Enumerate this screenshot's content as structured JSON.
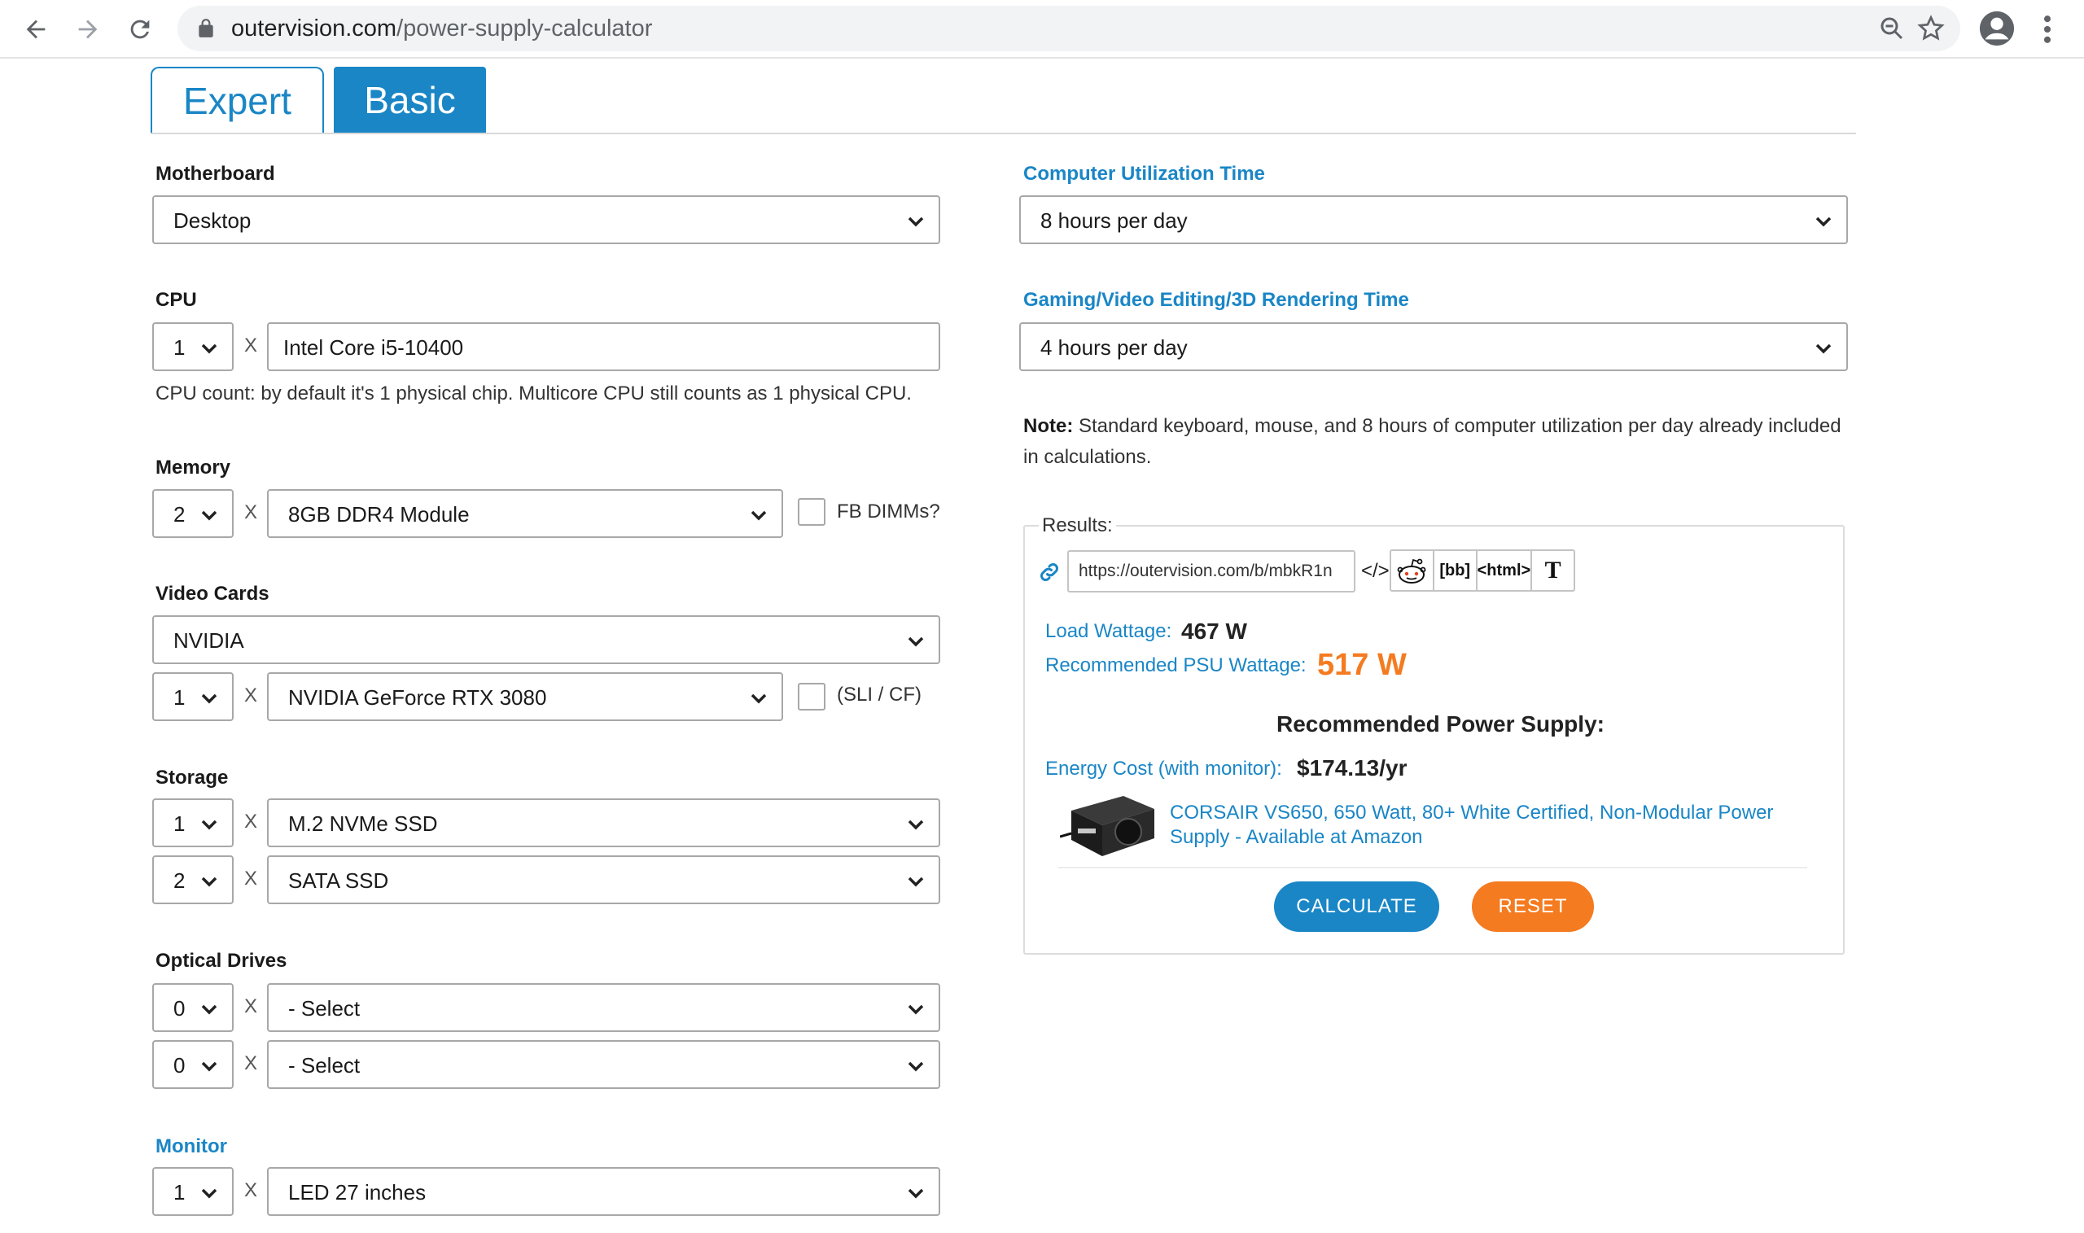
{
  "browser": {
    "url_host": "outervision.com",
    "url_path": "/power-supply-calculator"
  },
  "tabs": {
    "expert": "Expert",
    "basic": "Basic"
  },
  "motherboard": {
    "label": "Motherboard",
    "value": "Desktop"
  },
  "cpu": {
    "label": "CPU",
    "count": "1",
    "x": "X",
    "model": "Intel Core i5-10400",
    "help": "CPU count: by default it's 1 physical chip. Multicore CPU still counts as 1 physical CPU."
  },
  "memory": {
    "label": "Memory",
    "count": "2",
    "x": "X",
    "module": "8GB DDR4 Module",
    "fb_dimms_label": "FB DIMMs?",
    "fb_dimms_checked": false
  },
  "video_cards": {
    "label": "Video Cards",
    "brand": "NVIDIA",
    "count": "1",
    "x": "X",
    "model": "NVIDIA GeForce RTX 3080",
    "sli_label": "(SLI / CF)",
    "sli_checked": false
  },
  "storage": {
    "label": "Storage",
    "rows": [
      {
        "count": "1",
        "x": "X",
        "type": "M.2 NVMe SSD"
      },
      {
        "count": "2",
        "x": "X",
        "type": "SATA SSD"
      }
    ]
  },
  "optical": {
    "label": "Optical Drives",
    "rows": [
      {
        "count": "0",
        "x": "X",
        "type": "- Select"
      },
      {
        "count": "0",
        "x": "X",
        "type": "- Select"
      }
    ]
  },
  "monitor": {
    "label": "Monitor",
    "count": "1",
    "x": "X",
    "type": "LED 27 inches"
  },
  "utilization": {
    "label": "Computer Utilization Time",
    "value": "8 hours per day"
  },
  "gaming": {
    "label": "Gaming/Video Editing/3D Rendering Time",
    "value": "4 hours per day"
  },
  "note": {
    "bold": "Note:",
    "text": " Standard keyboard, mouse, and 8 hours of computer utilization per day already included in calculations."
  },
  "results": {
    "legend": "Results:",
    "share_url": "https://outervision.com/b/mbkR1n",
    "embed_symbol": "</>",
    "share_buttons": {
      "bb": "[bb]",
      "html": "<html>",
      "text": "T"
    },
    "load_label": "Load Wattage:",
    "load_value": "467 W",
    "psu_label": "Recommended PSU Wattage:",
    "psu_value": "517 W",
    "rec_heading": "Recommended Power Supply:",
    "energy_label": "Energy Cost (with monitor):",
    "energy_value": "$174.13/yr",
    "product_link": "CORSAIR VS650, 650 Watt, 80+ White Certified, Non-Modular Power Supply - Available at Amazon",
    "calculate": "CALCULATE",
    "reset": "RESET"
  },
  "colors": {
    "accent_blue": "#1a86c6",
    "accent_orange": "#f47b20"
  },
  "icons": [
    "back-icon",
    "forward-icon",
    "reload-icon",
    "lock-icon",
    "zoom-icon",
    "star-icon",
    "profile-icon",
    "menu-icon",
    "link-icon",
    "reddit-icon",
    "chevron-down-icon"
  ]
}
